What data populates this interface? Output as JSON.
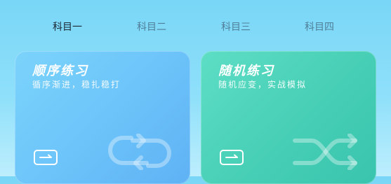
{
  "tabs": [
    {
      "label": "科目一",
      "active": true
    },
    {
      "label": "科目二",
      "active": false
    },
    {
      "label": "科目三",
      "active": false
    },
    {
      "label": "科目四",
      "active": false
    }
  ],
  "cards": {
    "sequential": {
      "title": "顺序练习",
      "subtitle": "循序渐进，稳扎稳打",
      "button_icon": "arrow-right-icon",
      "deco_icon": "loop-arrows-icon"
    },
    "random": {
      "title": "随机练习",
      "subtitle": "随机应变，实战模拟",
      "button_icon": "arrow-right-icon",
      "deco_icon": "shuffle-icon"
    }
  },
  "colors": {
    "background": "#8fe0fa",
    "sequential_card": "#6ec6fa",
    "random_card": "#49d0b7",
    "active_tab": "#1b2a36",
    "inactive_tab": "#4f7f99"
  }
}
